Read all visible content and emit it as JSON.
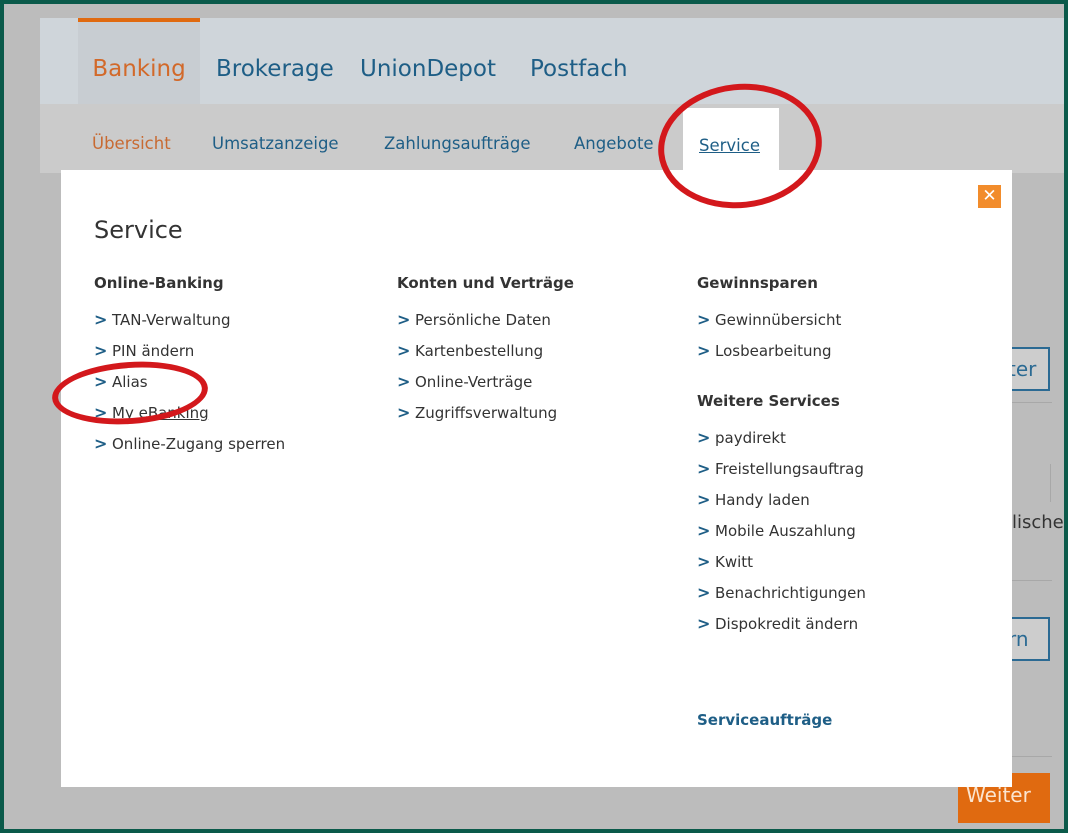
{
  "top_nav": {
    "tabs": [
      {
        "label": "Banking",
        "active": true
      },
      {
        "label": "Brokerage",
        "active": false
      },
      {
        "label": "UnionDepot",
        "active": false
      },
      {
        "label": "Postfach",
        "active": false
      }
    ]
  },
  "sub_nav": {
    "items": [
      {
        "label": "Übersicht",
        "active": true
      },
      {
        "label": "Umsatzanzeige",
        "active": false
      },
      {
        "label": "Zahlungsaufträge",
        "active": false
      },
      {
        "label": "Angebote",
        "active": false
      },
      {
        "label": "Service",
        "active": false
      }
    ]
  },
  "background": {
    "btn1_text": "ter",
    "text1": "lischer",
    "btn2_text": "rn",
    "weiter_label": "Weiter"
  },
  "modal": {
    "title": "Service",
    "close_glyph": "✕",
    "columns": [
      {
        "heading": "Online-Banking",
        "items": [
          "TAN-Verwaltung",
          "PIN ändern",
          "Alias",
          "My eBanking",
          "Online-Zugang sperren"
        ]
      },
      {
        "heading": "Konten und Verträge",
        "items": [
          "Persönliche Daten",
          "Kartenbestellung",
          "Online-Verträge",
          "Zugriffsverwaltung"
        ]
      },
      {
        "heading": "Gewinnsparen",
        "items": [
          "Gewinnübersicht",
          "Losbearbeitung"
        ],
        "heading2": "Weitere Services",
        "items2": [
          "paydirekt",
          "Freistellungsauftrag",
          "Handy laden",
          "Mobile Auszahlung",
          "Kwitt",
          "Benachrichtigungen",
          "Dispokredit ändern"
        ]
      }
    ],
    "footer_link": "Serviceaufträge"
  },
  "colors": {
    "annotation_red": "#d3181c",
    "accent_orange": "#e06a10",
    "link_blue": "#1e5e86"
  },
  "icons": {
    "chevron": "chevron-right-icon",
    "close": "close-icon"
  }
}
